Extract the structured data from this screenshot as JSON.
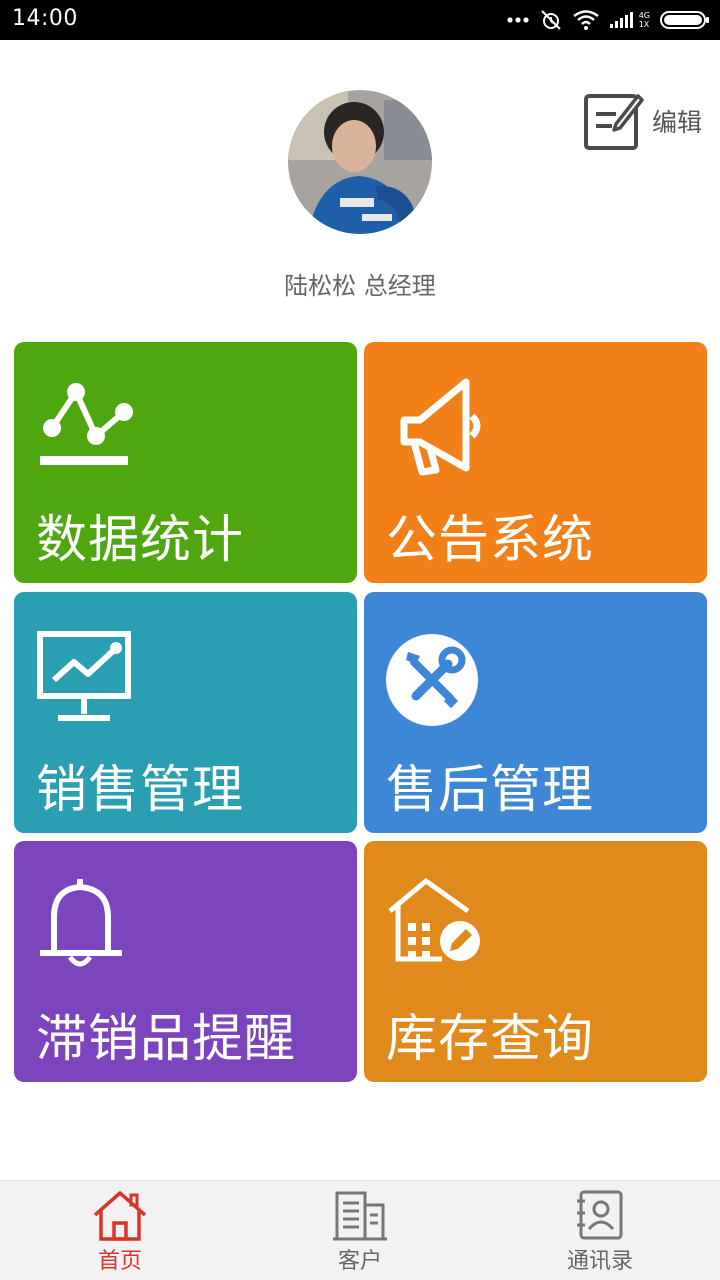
{
  "status_bar": {
    "time": "14:00",
    "network_top": "4G",
    "network_bottom": "1X"
  },
  "profile": {
    "edit_label": "编辑",
    "name": "陆松松 总经理"
  },
  "tiles": [
    {
      "label": "数据统计",
      "icon": "chart-line-icon",
      "color": "#4ea70f"
    },
    {
      "label": "公告系统",
      "icon": "megaphone-icon",
      "color": "#f08017"
    },
    {
      "label": "销售管理",
      "icon": "monitor-chart-icon",
      "color": "#2a9fb1"
    },
    {
      "label": "售后管理",
      "icon": "tools-icon",
      "color": "#3e86d6"
    },
    {
      "label": "滞销品提醒",
      "icon": "bell-icon",
      "color": "#7c45bd"
    },
    {
      "label": "库存查询",
      "icon": "building-edit-icon",
      "color": "#e08a1c"
    }
  ],
  "bottom_nav": {
    "items": [
      {
        "label": "首页",
        "icon": "home-icon",
        "active": true
      },
      {
        "label": "客户",
        "icon": "building-icon",
        "active": false
      },
      {
        "label": "通讯录",
        "icon": "contacts-icon",
        "active": false
      }
    ],
    "active_color": "#d9342b"
  }
}
